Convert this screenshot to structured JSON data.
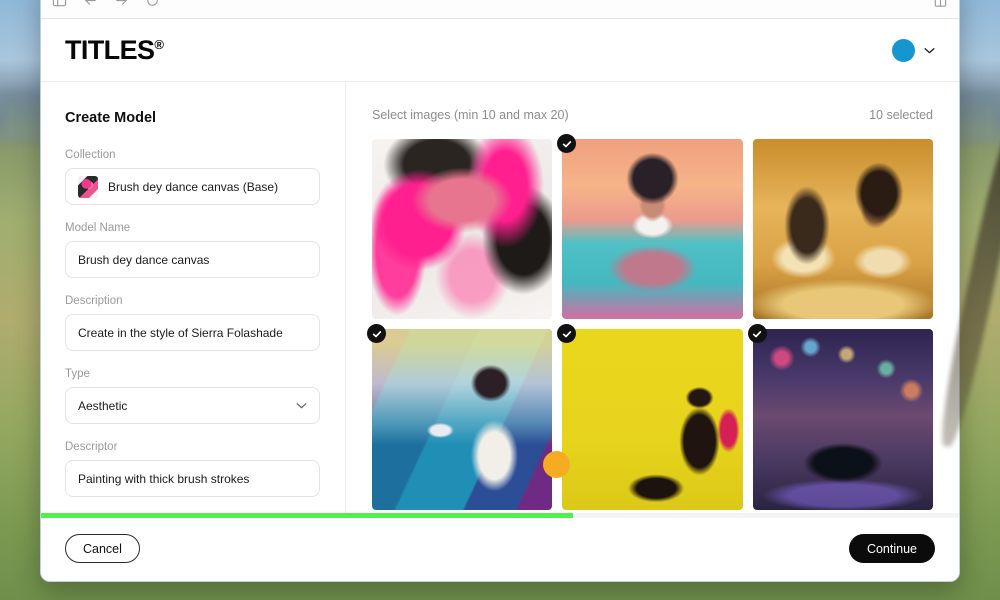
{
  "browser": {
    "icons": {
      "sidebar_toggle": "sidebar-toggle-icon",
      "back": "back-arrow-icon",
      "forward": "forward-arrow-icon",
      "reload": "reload-icon",
      "reader": "reader-view-icon"
    }
  },
  "header": {
    "brand": "TITLES",
    "brand_registered": "®",
    "avatar_color": "#1596cf",
    "account_menu_icon": "chevron-down-icon"
  },
  "form": {
    "title": "Create Model",
    "fields": [
      {
        "label": "Collection",
        "value": "Brush dey dance canvas (Base)",
        "type": "thumb-value",
        "name": "collection"
      },
      {
        "label": "Model Name",
        "value": "Brush dey dance canvas",
        "placeholder": "Model Name",
        "type": "text",
        "name": "model-name"
      },
      {
        "label": "Description",
        "value": "Create in the style of Sierra Folashade",
        "placeholder": "Description",
        "type": "text",
        "name": "description"
      },
      {
        "label": "Type",
        "value": "Aesthetic",
        "type": "select",
        "name": "type"
      },
      {
        "label": "Descriptor",
        "value": "Painting with thick brush strokes",
        "placeholder": "Descriptor",
        "type": "text",
        "name": "descriptor"
      }
    ]
  },
  "images": {
    "heading": "Select images (min 10 and max 20)",
    "count_label": "10 selected",
    "selected_count": 10,
    "min": 10,
    "max": 20,
    "items": [
      {
        "id": "img-1",
        "art_class": "art-1",
        "selected": false,
        "description": "Pink and black expressive portrait of a face with full lips"
      },
      {
        "id": "img-2",
        "art_class": "art-2",
        "selected": true,
        "description": "Seated woman with afro on teal floor, peach background"
      },
      {
        "id": "img-3",
        "art_class": "art-3",
        "selected": false,
        "description": "Couple at a golden candlelit table with wine glass"
      },
      {
        "id": "img-4",
        "art_class": "art-4",
        "selected": true,
        "description": "Woman in white top viewing a painting of a car on a road"
      },
      {
        "id": "img-5",
        "art_class": "art-5",
        "selected": true,
        "description": "Dark silhouetted figure seated against bright yellow field"
      },
      {
        "id": "img-6",
        "art_class": "art-6",
        "selected": true,
        "description": "Neon rainy night city street with a parked car"
      }
    ],
    "check_icon": "check-icon"
  },
  "footer": {
    "progress_percent": 58,
    "progress_color": "#55ef4c",
    "cancel_label": "Cancel",
    "continue_label": "Continue"
  },
  "cursor": {
    "name": "mouse-cursor-dot",
    "color": "#f6ac22"
  }
}
